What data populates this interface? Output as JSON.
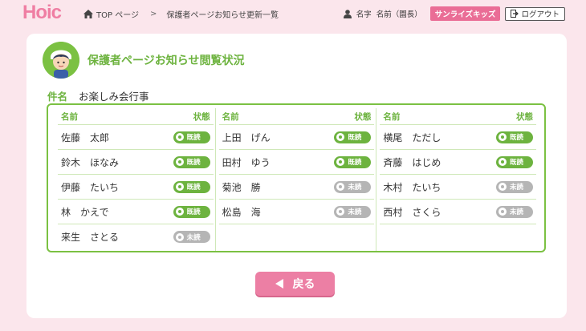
{
  "header": {
    "logo": "Hoic",
    "breadcrumb": [
      "TOP ページ",
      "保護者ページお知らせ更新一覧"
    ],
    "user": {
      "name_label": "名字",
      "name": "名前（園長）"
    },
    "school": "サンライズキッズ",
    "logout": "ログアウト"
  },
  "main": {
    "title": "保護者ページお知らせ閲覧状況",
    "subject_label": "件名",
    "subject": "お楽しみ会行事",
    "col_headers": {
      "name": "名前",
      "status": "状態"
    },
    "columns": [
      [
        {
          "name": "佐藤　太郎",
          "status": "既読"
        },
        {
          "name": "鈴木　ほなみ",
          "status": "既読"
        },
        {
          "name": "伊藤　たいち",
          "status": "既読"
        },
        {
          "name": "林　かえで",
          "status": "既読"
        },
        {
          "name": "来生　さとる",
          "status": "未読"
        }
      ],
      [
        {
          "name": "上田　げん",
          "status": "既読"
        },
        {
          "name": "田村　ゆう",
          "status": "既読"
        },
        {
          "name": "菊池　勝",
          "status": "未読"
        },
        {
          "name": "松島　海",
          "status": "未読"
        }
      ],
      [
        {
          "name": "横尾　ただし",
          "status": "既読"
        },
        {
          "name": "斉藤　はじめ",
          "status": "既読"
        },
        {
          "name": "木村　たいち",
          "status": "未読"
        },
        {
          "name": "西村　さくら",
          "status": "未読"
        }
      ]
    ],
    "back": "戻る"
  },
  "colors": {
    "accent_green": "#6db33f",
    "accent_pink": "#ec7fa4",
    "background": "#fbe6ec",
    "unread_gray": "#b5b5b5"
  }
}
